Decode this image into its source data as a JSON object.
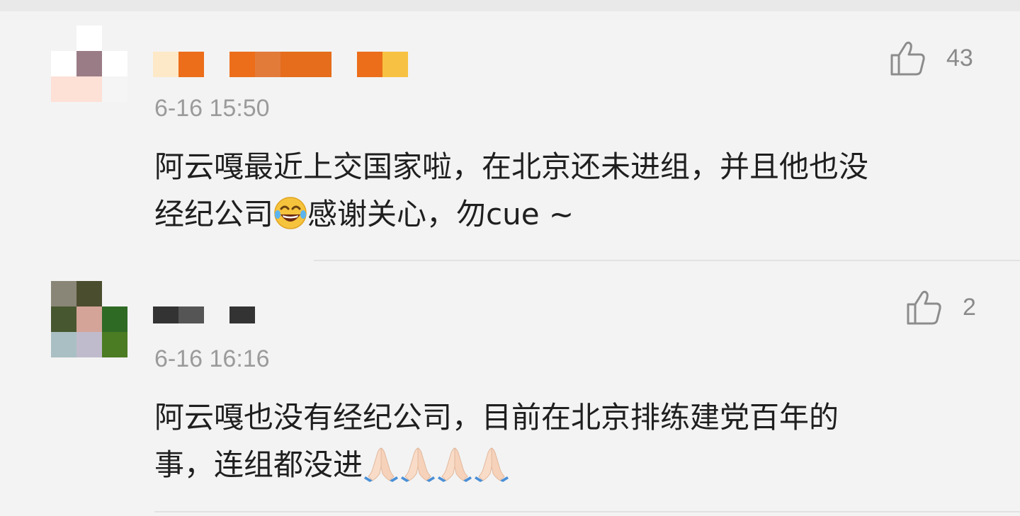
{
  "comments": [
    {
      "timestamp": "6-16 15:50",
      "likes": "43",
      "text_line1": "阿云嘎最近上交国家啦，在北京还未进组，并且他也没",
      "text_line2_a": "经纪公司",
      "text_line2_b": "感谢关心，勿cue ~",
      "inline_emoji": "laughing-crying-emoji",
      "avatar_colors": [
        "#f3f3f3",
        "#ffffff",
        "#f3f3f3",
        "#ffffff",
        "#9a7c86",
        "#ffffff",
        "#fde0d6",
        "#fde0d6",
        "#f5f5f5"
      ],
      "name_colors": [
        "#fde9c8",
        "#ec6e1a",
        "#ec6e1a",
        "#e27a3a",
        "#e56d1c",
        "#ec6e1a",
        "#f7c243"
      ]
    },
    {
      "timestamp": "6-16 16:16",
      "likes": "2",
      "text_line1": "阿云嘎也没有经纪公司，目前在北京排练建党百年的",
      "text_line2": "事，连组都没进",
      "inline_emoji": "folded-hands-emoji",
      "avatar_colors": [
        "#8a8677",
        "#4b4d2f",
        "#f3f3f3",
        "#475730",
        "#d4a498",
        "#2f6a25",
        "#a9bfc3",
        "#c0bbcc",
        "#4b7b22"
      ],
      "name_colors": [
        "#333333",
        "#555555",
        "#333333"
      ]
    }
  ]
}
